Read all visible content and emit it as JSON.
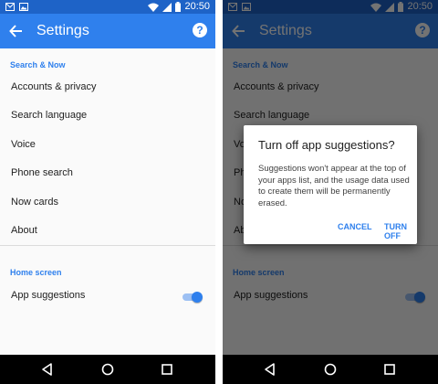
{
  "status_bar": {
    "time": "20:50",
    "icons": [
      "mail-icon",
      "image-icon",
      "wifi-icon",
      "signal-icon",
      "battery-icon"
    ]
  },
  "app_bar": {
    "title": "Settings",
    "help_glyph": "?"
  },
  "sections": [
    {
      "header": "Search & Now",
      "items": [
        {
          "label": "Accounts & privacy"
        },
        {
          "label": "Search language"
        },
        {
          "label": "Voice"
        },
        {
          "label": "Phone search"
        },
        {
          "label": "Now cards"
        },
        {
          "label": "About"
        }
      ]
    },
    {
      "header": "Home screen",
      "items": [
        {
          "label": "App suggestions",
          "toggle": true,
          "enabled": true
        }
      ]
    }
  ],
  "dialog": {
    "title": "Turn off app suggestions?",
    "body": "Suggestions won't appear at the top of your apps list, and the usage data used to create them will be permanently erased.",
    "cancel_label": "CANCEL",
    "confirm_label": "TURN OFF"
  },
  "colors": {
    "status_bar": "#1e63c7",
    "app_bar": "#2f80ed",
    "accent": "#2f80ed",
    "nav_bar": "#000000"
  }
}
